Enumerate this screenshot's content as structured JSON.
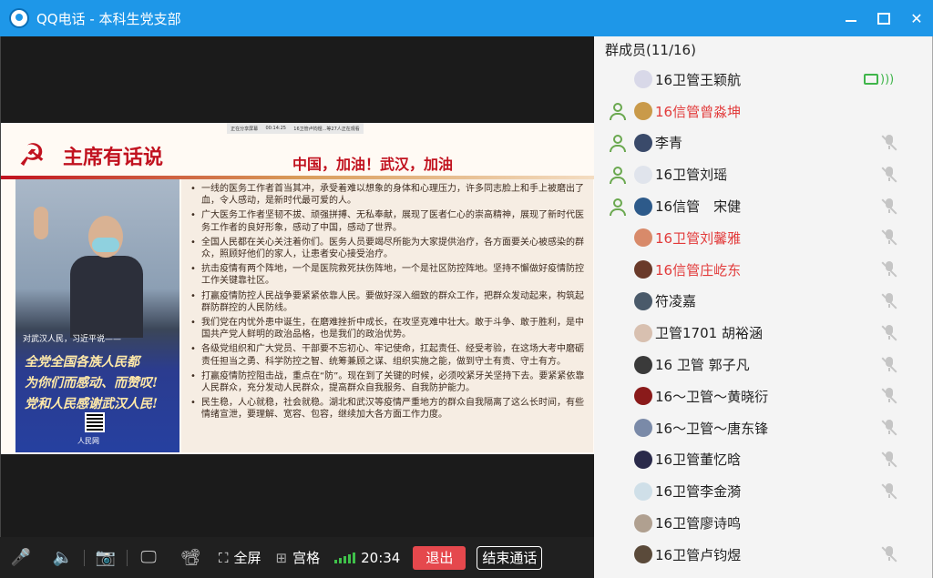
{
  "window": {
    "title": "QQ电话 - 本科生党支部",
    "close_glyph": "✕"
  },
  "slide": {
    "top_strip": [
      "正在分享屏幕",
      "00:14:25",
      "16卫管卢钧煜...等27人正在观看"
    ],
    "title": "主席有话说",
    "emblem_glyph": "☭",
    "slogan": "中国，加油！武汉，加油",
    "photo_caption": "对武汉人民，习近平说——",
    "photo_quote": [
      "全党全国各族人民都",
      "为你们而感动、而赞叹!",
      "党和人民感谢武汉人民!"
    ],
    "photo_brand": "人民网",
    "bullets": [
      "一线的医务工作者首当其冲，承受着难以想象的身体和心理压力，许多同志脸上和手上被磨出了血，令人感动，是新时代最可爱的人。",
      "广大医务工作者坚韧不拔、顽强拼搏、无私奉献，展现了医者仁心的崇高精神，展现了新时代医务工作者的良好形象，感动了中国，感动了世界。",
      "全国人民都在关心关注着你们。医务人员要竭尽所能为大家提供治疗，各方面要关心被感染的群众，照顾好他们的家人，让患者安心接受治疗。",
      "抗击疫情有两个阵地，一个是医院救死扶伤阵地，一个是社区防控阵地。坚持不懈做好疫情防控工作关键靠社区。",
      "打赢疫情防控人民战争要紧紧依靠人民。要做好深入细致的群众工作，把群众发动起来，构筑起群防群控的人民防线。",
      "我们党在内忧外患中诞生，在磨难挫折中成长，在攻坚克难中壮大。敢于斗争、敢于胜利，是中国共产党人鲜明的政治品格，也是我们的政治优势。",
      "各级党组织和广大党员、干部要不忘初心、牢记使命，扛起责任、经受考验，在这场大考中磨砺责任担当之勇、科学防控之智、统筹兼顾之谋、组织实施之能，做到守土有责、守土有方。",
      "打赢疫情防控阻击战，重点在“防”。现在到了关键的时候，必须咬紧牙关坚持下去。要紧紧依靠人民群众，充分发动人民群众，提高群众自我服务、自我防护能力。",
      "民生稳，人心就稳，社会就稳。湖北和武汉等疫情严重地方的群众自我隔离了这么长时间，有些情绪宣泄，要理解、宽容、包容，继续加大各方面工作力度。"
    ]
  },
  "toolbar": {
    "fullscreen_label": "全屏",
    "grid_label": "宫格",
    "time": "20:34",
    "exit_label": "退出",
    "end_call_label": "结束通话",
    "icons": {
      "mic": "🎤",
      "speaker": "🔈",
      "camera": "📷",
      "share": "🖵",
      "projector": "📽",
      "fullscreen": "⛶",
      "grid": "⊞"
    }
  },
  "members": {
    "header": "群成员(11/16)",
    "list": [
      {
        "name": "16卫管王颖航",
        "host": false,
        "red": false,
        "status": "active",
        "avatar_color": "#d8d8e8"
      },
      {
        "name": "16信管曾淼坤",
        "host": true,
        "red": true,
        "status": "none",
        "avatar_color": "#c99a4a"
      },
      {
        "name": "李青",
        "host": true,
        "red": false,
        "status": "muted",
        "avatar_color": "#3a4a6a"
      },
      {
        "name": "16卫管刘瑶",
        "host": true,
        "red": false,
        "status": "muted",
        "avatar_color": "#e0e4ec"
      },
      {
        "name": "16信管　宋健",
        "host": true,
        "red": false,
        "status": "muted",
        "avatar_color": "#2d5a8a"
      },
      {
        "name": "16卫管刘馨雅",
        "host": false,
        "red": true,
        "status": "muted",
        "avatar_color": "#d88a6a"
      },
      {
        "name": "16信管庄屹东",
        "host": false,
        "red": true,
        "status": "muted",
        "avatar_color": "#6a3a2a"
      },
      {
        "name": "符凌嘉",
        "host": false,
        "red": false,
        "status": "muted",
        "avatar_color": "#4a5a6a"
      },
      {
        "name": "卫管1701 胡裕涵",
        "host": false,
        "red": false,
        "status": "muted",
        "avatar_color": "#d8c0b0"
      },
      {
        "name": "16 卫管 郭子凡",
        "host": false,
        "red": false,
        "status": "muted",
        "avatar_color": "#3a3a3a"
      },
      {
        "name": "16～卫管～黄晓衍",
        "host": false,
        "red": false,
        "status": "muted",
        "avatar_color": "#8a1a1a"
      },
      {
        "name": "16～卫管～唐东锋",
        "host": false,
        "red": false,
        "status": "muted",
        "avatar_color": "#7a8aa8"
      },
      {
        "name": "16卫管董忆晗",
        "host": false,
        "red": false,
        "status": "muted",
        "avatar_color": "#2a2a4a"
      },
      {
        "name": "16卫管李金漪",
        "host": false,
        "red": false,
        "status": "muted",
        "avatar_color": "#cfdfe8"
      },
      {
        "name": "16卫管廖诗鸣",
        "host": false,
        "red": false,
        "status": "none",
        "avatar_color": "#b0a090"
      },
      {
        "name": "16卫管卢钧煜",
        "host": false,
        "red": false,
        "status": "muted",
        "avatar_color": "#5a4a3a"
      }
    ]
  }
}
